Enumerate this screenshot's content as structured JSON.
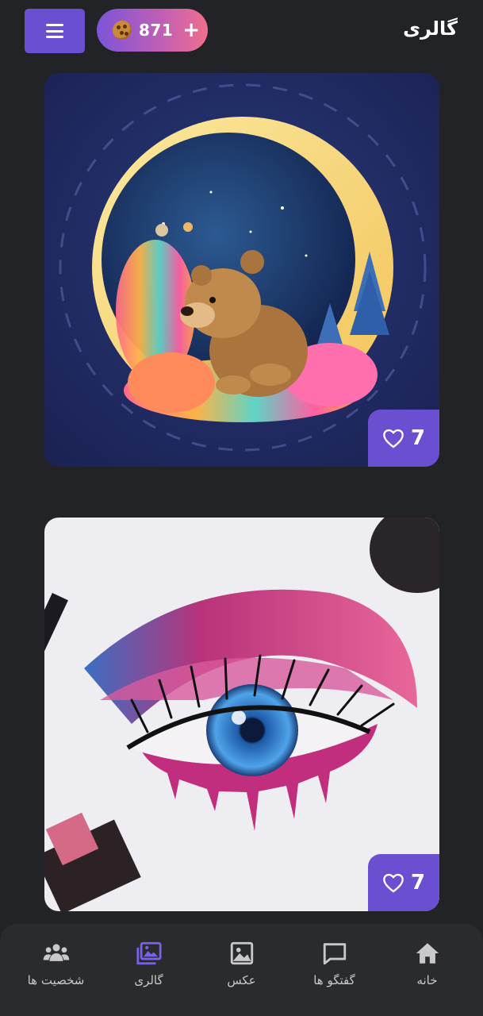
{
  "header": {
    "title": "گالری",
    "credits": {
      "count": "871",
      "plus": "+",
      "icon": "cookie-icon"
    },
    "menu_icon": "hamburger-menu-icon"
  },
  "gallery": {
    "cards": [
      {
        "likes": "7",
        "heart_icon": "heart-outline-icon"
      },
      {
        "likes": "7",
        "heart_icon": "heart-outline-icon"
      }
    ]
  },
  "bottom_nav": {
    "items": [
      {
        "label": "خانه",
        "icon": "home-icon"
      },
      {
        "label": "گفتگو ها",
        "icon": "chat-bubble-icon"
      },
      {
        "label": "عکس",
        "icon": "image-icon"
      },
      {
        "label": "گالری",
        "icon": "gallery-icon",
        "active": true
      },
      {
        "label": "شخصیت ها",
        "icon": "people-icon"
      }
    ],
    "active_color": "#7a62e6",
    "inactive_color": "#c9c9cc"
  },
  "colors": {
    "background": "#222326",
    "accent": "#6a4fd0",
    "nav_background": "#2a2b2f"
  }
}
